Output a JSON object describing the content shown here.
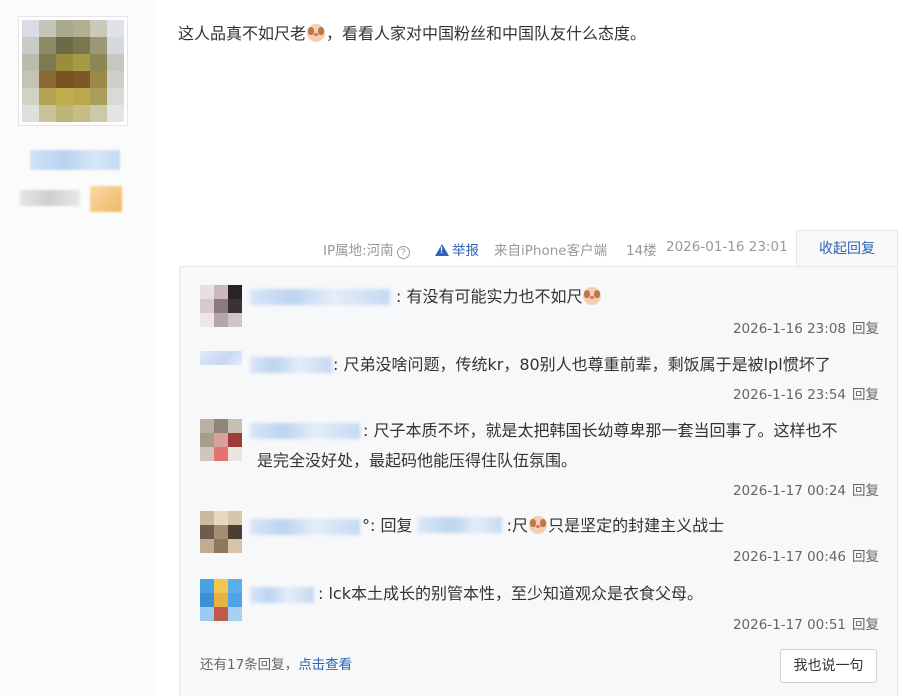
{
  "post": {
    "content_before": "这人品真不如尺老",
    "content_after": "，看看人家对中国粉丝和中国队友什么态度。",
    "emoji": "dog-face-emoji"
  },
  "meta": {
    "ip": "IP属地:河南",
    "report": "举报",
    "source": "来自iPhone客户端",
    "floor": "14楼",
    "date": "2026-01-16 23:01",
    "collapse": "收起回复"
  },
  "replies": [
    {
      "text": ": 有没有可能实力也不如尺",
      "emoji_after": true,
      "time": "2026-1-16 23:08",
      "reply": "回复"
    },
    {
      "text": ": 尺弟没啥问题，传统kr，80别人也尊重前辈，剩饭属于是被lpl惯坏了",
      "time": "2026-1-16 23:54",
      "reply": "回复"
    },
    {
      "line1": ": 尺子本质不坏，就是太把韩国长幼尊卑那一套当回事了。这样也不",
      "line2": "是完全没好处，最起码他能压得住队伍氛围。",
      "time": "2026-1-17 00:24",
      "reply": "回复"
    },
    {
      "prefix": "°: 回复",
      "text_a": " :尺",
      "text_b": "只是坚定的封建主义战士",
      "time": "2026-1-17 00:46",
      "reply": "回复"
    },
    {
      "text": ": lck本土成长的别管本性，至少知道观众是衣食父母。",
      "time": "2026-1-17 00:51",
      "reply": "回复"
    }
  ],
  "footer": {
    "more_text": "还有17条回复，",
    "more_link": "点击查看",
    "say_button": "我也说一句"
  },
  "colors": {
    "link": "#2d64b3",
    "panel_bg": "#f7f8fa",
    "meta_text": "#999999"
  }
}
